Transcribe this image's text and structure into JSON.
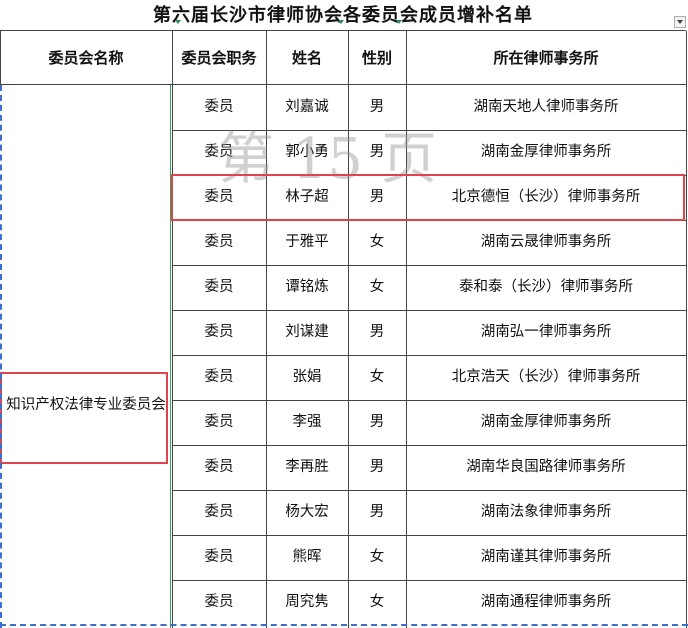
{
  "title": "第六届长沙市律师协会各委员会成员增补名单",
  "headers": {
    "committee_name": "委员会名称",
    "position": "委员会职务",
    "name": "姓名",
    "gender": "性别",
    "firm": "所在律师事务所"
  },
  "committee": "知识产权法律专业委员会",
  "watermark": "第 15 页",
  "rows": [
    {
      "position": "委员",
      "name": "刘嘉诚",
      "gender": "男",
      "firm": "湖南天地人律师事务所"
    },
    {
      "position": "委员",
      "name": "郭小勇",
      "gender": "男",
      "firm": "湖南金厚律师事务所"
    },
    {
      "position": "委员",
      "name": "林子超",
      "gender": "男",
      "firm": "北京德恒（长沙）律师事务所"
    },
    {
      "position": "委员",
      "name": "于雅平",
      "gender": "女",
      "firm": "湖南云晟律师事务所"
    },
    {
      "position": "委员",
      "name": "谭铭炼",
      "gender": "女",
      "firm": "泰和泰（长沙）律师事务所"
    },
    {
      "position": "委员",
      "name": "刘谋建",
      "gender": "男",
      "firm": "湖南弘一律师事务所"
    },
    {
      "position": "委员",
      "name": "张娟",
      "gender": "女",
      "firm": "北京浩天（长沙）律师事务所"
    },
    {
      "position": "委员",
      "name": "李强",
      "gender": "男",
      "firm": "湖南金厚律师事务所"
    },
    {
      "position": "委员",
      "name": "李再胜",
      "gender": "男",
      "firm": "湖南华良国路律师事务所"
    },
    {
      "position": "委员",
      "name": "杨大宏",
      "gender": "男",
      "firm": "湖南法象律师事务所"
    },
    {
      "position": "委员",
      "name": "熊晖",
      "gender": "女",
      "firm": "湖南谨其律师事务所"
    },
    {
      "position": "委员",
      "name": "周究隽",
      "gender": "女",
      "firm": "湖南通程律师事务所"
    }
  ],
  "highlight": {
    "row_index": 2,
    "accent": "#e0454c"
  },
  "colors": {
    "grid": "#444444",
    "highlight": "#e0454c",
    "selection": "#3a6fd0",
    "watermark": "#969696"
  }
}
